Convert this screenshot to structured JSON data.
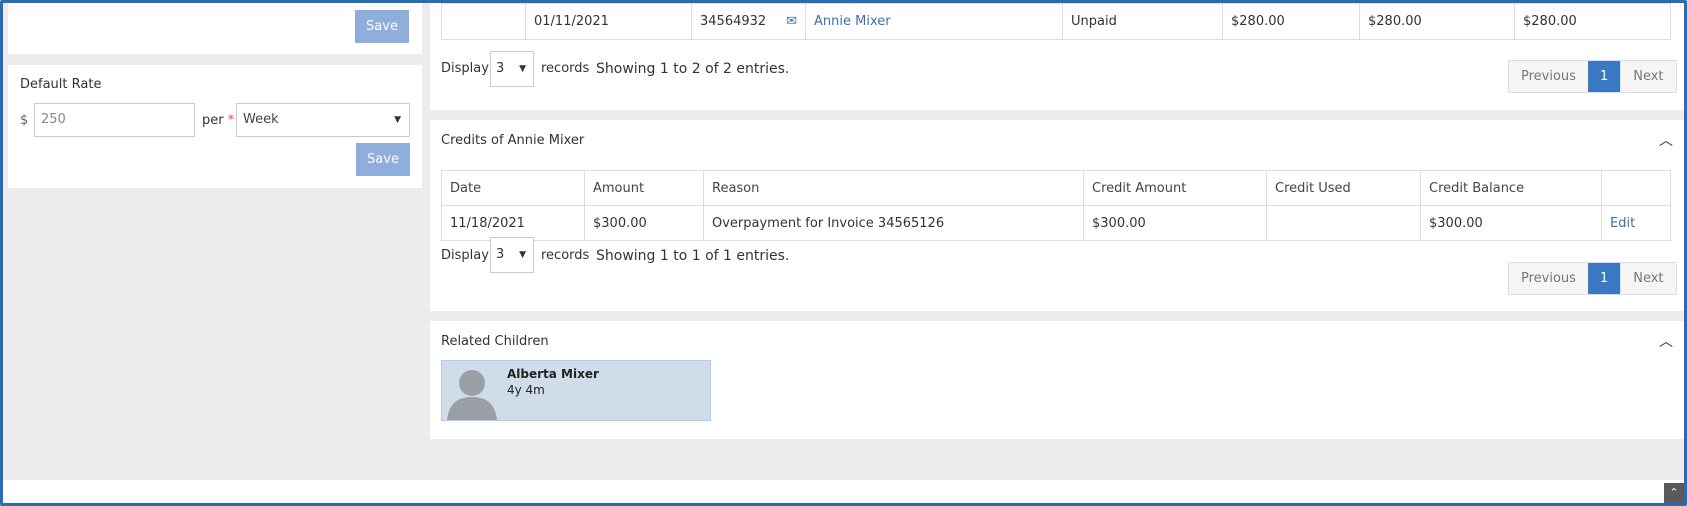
{
  "left": {
    "save_label_top": "Save",
    "default_rate": {
      "title": "Default Rate",
      "currency": "$",
      "amount_placeholder": "250",
      "per_label": "per",
      "required_mark": "*",
      "period_value": "Week",
      "save_label": "Save"
    }
  },
  "invoices_table": {
    "row": {
      "date": "01/11/2021",
      "number": "34564932",
      "name": "Annie Mixer",
      "status": "Unpaid",
      "amount": "$280.00",
      "paid": "$280.00",
      "balance": "$280.00"
    },
    "display_label": "Display",
    "display_value": "3",
    "records_label": "records",
    "showing": "Showing 1 to 2 of 2 entries.",
    "pager": {
      "previous": "Previous",
      "page": "1",
      "next": "Next"
    }
  },
  "credits": {
    "title": "Credits of Annie Mixer",
    "columns": [
      "Date",
      "Amount",
      "Reason",
      "Credit Amount",
      "Credit Used",
      "Credit Balance",
      ""
    ],
    "rows": [
      {
        "date": "11/18/2021",
        "amount": "$300.00",
        "reason": "Overpayment for Invoice 34565126",
        "credit_amount": "$300.00",
        "credit_used": "",
        "credit_balance": "$300.00",
        "action": "Edit"
      }
    ],
    "display_label": "Display",
    "display_value": "3",
    "records_label": "records",
    "showing": "Showing 1 to 1 of 1 entries.",
    "pager": {
      "previous": "Previous",
      "page": "1",
      "next": "Next"
    }
  },
  "related_children": {
    "title": "Related Children",
    "children": [
      {
        "name": "Alberta Mixer",
        "age": "4y 4m"
      }
    ]
  },
  "icons": {
    "envelope": "envelope-icon",
    "chevron": "chevron-up-icon",
    "scroll_top": "double-chevron-up-icon",
    "avatar": "avatar-icon"
  },
  "colors": {
    "accent": "#3a78c3",
    "save_button": "#8faedb",
    "link": "#3a6fb0",
    "child_card": "#cfdcea"
  }
}
